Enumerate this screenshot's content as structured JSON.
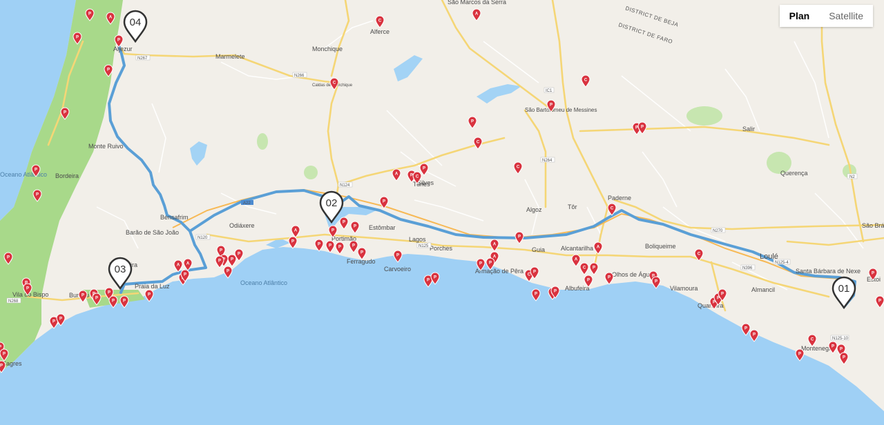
{
  "map_type": {
    "options": [
      {
        "label": "Plan",
        "active": true
      },
      {
        "label": "Satellite",
        "active": false
      }
    ]
  },
  "colors": {
    "sea": "#9fd0f5",
    "land": "#f2efe9",
    "coast_green": "#a8d98a",
    "route": "#5a9fd6",
    "road_major": "#f5d676",
    "poi": "#d9333f"
  },
  "waypoints": [
    {
      "label": "01",
      "at": "near Santa Bárbara de Nexe"
    },
    {
      "label": "02",
      "at": "Portimão"
    },
    {
      "label": "03",
      "at": "near Praia da Luz"
    },
    {
      "label": "04",
      "at": "Aljezur"
    }
  ],
  "places": [
    "São Marcos da Serra",
    "Marmelete",
    "Monchique",
    "Alferce",
    "Caldas de Monchique",
    "São Bartolomeu de Messines",
    "Monte Ruivo",
    "Bordeira",
    "Salir",
    "Querença",
    "Bensafrim",
    "Barão de São João",
    "Odiáxere",
    "Estômbar",
    "Lagos",
    "Portimão",
    "Ferragudo",
    "Carvoeiro",
    "Porches",
    "Guia",
    "Algoz",
    "Tunes",
    "Paderne",
    "Tôr",
    "Alcantarilha",
    "Armação de Pêra",
    "Albufeira",
    "Olhos de Água",
    "Boliqueime",
    "Vilamoura",
    "Quarteira",
    "Almancil",
    "Loulé",
    "Santa Bárbara de Nexe",
    "Montenegro",
    "Estoi",
    "São Brás de Alportel",
    "Vila do Bispo",
    "Raposeira",
    "Praia da Luz",
    "Burgau",
    "Sagres",
    "Aljezur",
    "Silves"
  ],
  "ocean_label": "Oceano Atlântico",
  "ocean_label_west": "Oceano Atlântico",
  "districts": [
    "DISTRICT DE BEJA",
    "DISTRICT DE FARO"
  ],
  "road_refs": [
    "N267",
    "N266",
    "N124",
    "A22",
    "N125",
    "N120",
    "N270",
    "N264",
    "N2",
    "IC1",
    "N268",
    "N396",
    "N125-4",
    "N125-10"
  ],
  "poi_symbols": [
    "P",
    "A",
    "C"
  ]
}
